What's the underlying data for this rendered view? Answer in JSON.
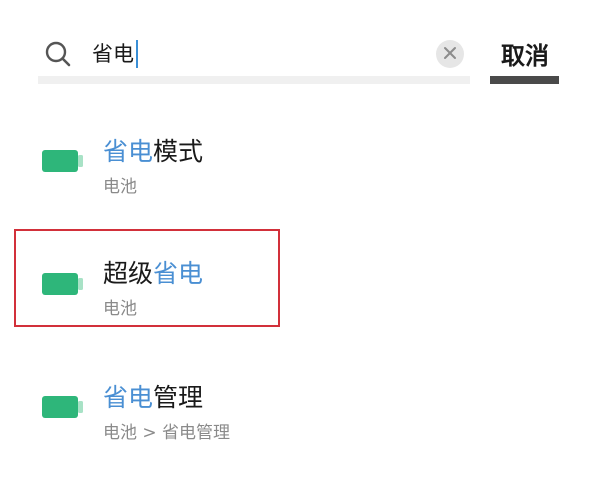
{
  "search": {
    "query": "省电",
    "clear_icon": "close-icon",
    "search_icon": "search-icon"
  },
  "cancel": {
    "label": "取消"
  },
  "results": [
    {
      "title_highlight": "省电",
      "title_rest": "模式",
      "subtitle": "电池",
      "icon": "battery-icon"
    },
    {
      "title_prefix": "超级",
      "title_highlight": "省电",
      "subtitle": "电池",
      "icon": "battery-icon"
    },
    {
      "title_highlight": "省电",
      "title_rest": "管理",
      "subtitle": "电池 > 省电管理",
      "icon": "battery-icon"
    }
  ],
  "colors": {
    "highlight_text": "#4a8fd3",
    "battery": "#2eb67a",
    "selection_frame": "#d2303a"
  }
}
